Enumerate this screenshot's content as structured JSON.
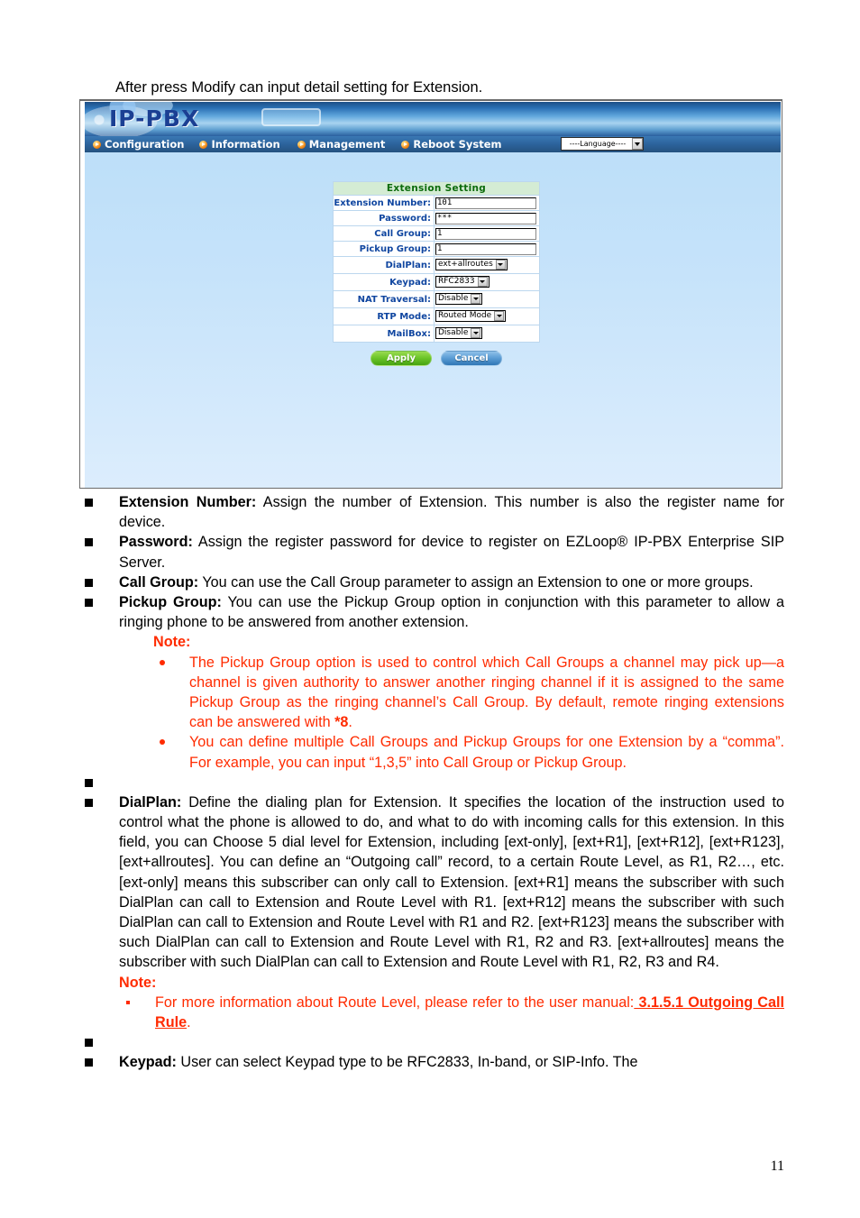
{
  "document": {
    "caption": "After press Modify can input detail setting for Extension.",
    "page_number": "11"
  },
  "screenshot": {
    "logo": "IP-PBX",
    "nav": {
      "items": [
        {
          "label": "Configuration",
          "icon": "orange-play-bullet-icon"
        },
        {
          "label": "Information",
          "icon": "orange-play-bullet-icon"
        },
        {
          "label": "Management",
          "icon": "orange-play-bullet-icon"
        },
        {
          "label": "Reboot System",
          "icon": "orange-play-bullet-icon"
        }
      ],
      "language_select": {
        "value": "----Language----",
        "options": [
          "----Language----"
        ]
      }
    },
    "form": {
      "title": "Extension Setting",
      "fields": [
        {
          "label": "Extension Number:",
          "type": "text",
          "value": "101"
        },
        {
          "label": "Password:",
          "type": "text",
          "value": "***"
        },
        {
          "label": "Call Group:",
          "type": "text",
          "value": "1"
        },
        {
          "label": "Pickup Group:",
          "type": "text",
          "value": "1"
        },
        {
          "label": "DialPlan:",
          "type": "select",
          "value": "ext+allroutes"
        },
        {
          "label": "Keypad:",
          "type": "select",
          "value": "RFC2833"
        },
        {
          "label": "NAT Traversal:",
          "type": "select",
          "value": "Disable"
        },
        {
          "label": "RTP Mode:",
          "type": "select",
          "value": "Routed Mode"
        },
        {
          "label": "MailBox:",
          "type": "select",
          "value": "Disable"
        }
      ],
      "buttons": {
        "apply": "Apply",
        "cancel": "Cancel"
      }
    },
    "colors": {
      "banner_blue": "#2b70b4",
      "nav_blue": "#2c639c",
      "form_title_bg": "#d4ecd4",
      "form_title_text": "#0c6b0c",
      "label_text": "#1046a0",
      "apply_green": "#6ec62a",
      "cancel_blue": "#5e9fd6"
    }
  },
  "body": {
    "bullets": {
      "extension_number_term": "Extension Number:",
      "extension_number_text": " Assign the number of Extension. This number is also the register name for device.",
      "password_term": "Password:",
      "password_text": " Assign the register password for device to register on EZLoop® IP-PBX Enterprise SIP Server.",
      "call_group_term": "Call Group:",
      "call_group_text": " You can use the Call Group parameter to assign an Extension to one or more groups.",
      "pickup_group_term": "Pickup Group:",
      "pickup_group_text": " You can use the Pickup Group option in conjunction with this parameter to allow a ringing phone to be answered from another extension.",
      "dialplan_term": "DialPlan:",
      "dialplan_text": " Define the dialing plan for Extension. It specifies the location of the instruction used to control what the phone is allowed to do, and what to do with incoming calls for this extension. In this field, you can Choose 5 dial level for Extension, including [ext-only], [ext+R1], [ext+R12], [ext+R123], [ext+allroutes]. You can define an “Outgoing call” record, to a certain Route Level, as R1, R2…, etc. [ext-only] means this subscriber can only call to Extension. [ext+R1] means the subscriber with such DialPlan can call to Extension and Route Level with R1. [ext+R12] means the subscriber with such DialPlan can call to Extension and Route Level with R1 and R2. [ext+R123] means the subscriber with such DialPlan can call to Extension and Route Level with R1, R2 and R3. [ext+allroutes] means the subscriber with such DialPlan can call to Extension and Route Level with R1, R2, R3 and R4.",
      "keypad_term": "Keypad:",
      "keypad_text": " User can select Keypad type to be RFC2833, In-band, or SIP-Info. The"
    },
    "note1": {
      "heading": "Note:",
      "item1_a": "The Pickup Group option is used to control which Call Groups a channel may pick up—a channel is given authority to answer another ringing channel if it is assigned to the same Pickup Group as the ringing channel’s Call Group. By default, remote ringing extensions can be answered with ",
      "item1_b": "*8",
      "item1_c": ".",
      "item2": "You can define multiple Call Groups and Pickup Groups for one Extension by a “comma”. For example, you can input “1,3,5” into Call Group or Pickup Group."
    },
    "note2": {
      "heading": "Note:",
      "item1_a": "For more information about Route Level, please refer to the user manual:",
      "item1_link": " 3.1.5.1 Outgoing Call Rule",
      "item1_b": "."
    }
  }
}
